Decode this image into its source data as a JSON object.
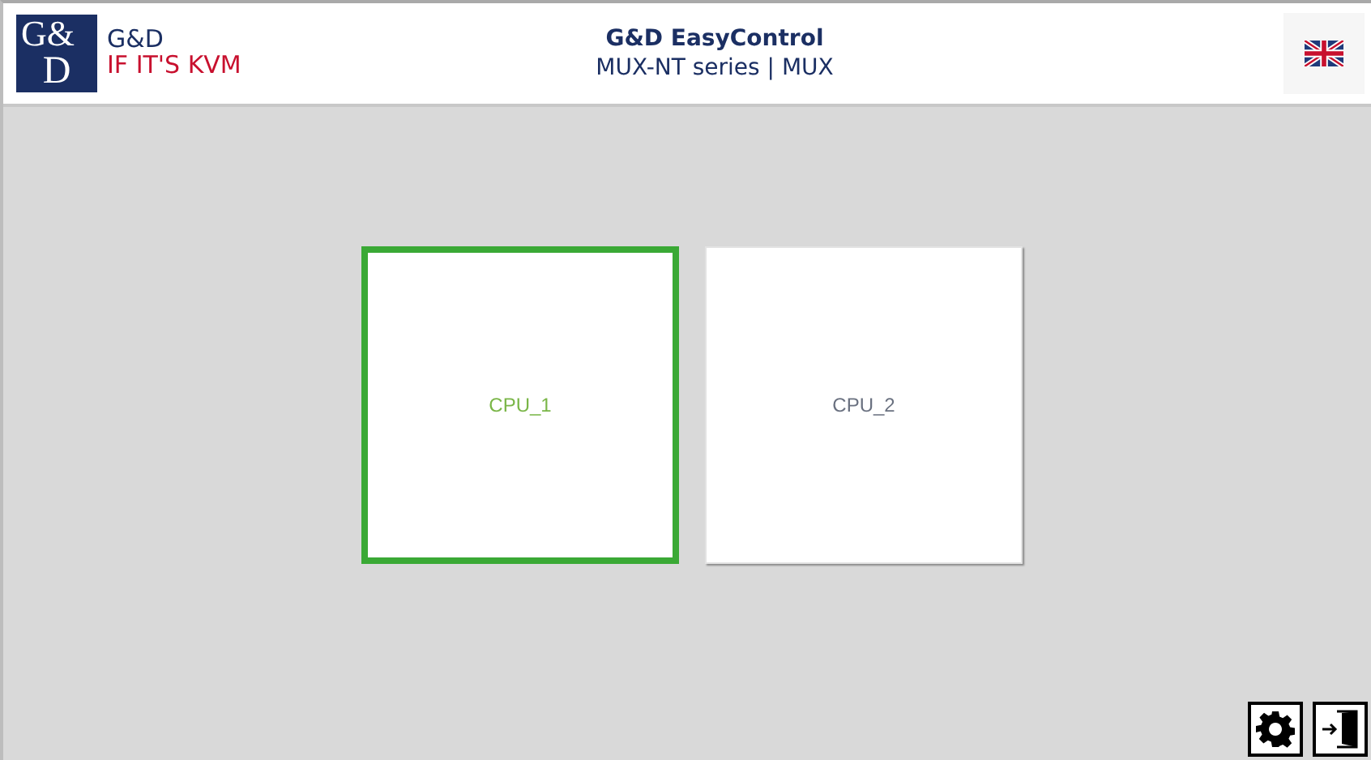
{
  "header": {
    "logo_mark": [
      "G&",
      "D"
    ],
    "brand": "G&D",
    "slogan": "IF IT'S KVM",
    "title": "G&D EasyControl",
    "subtitle": "MUX-NT series | MUX"
  },
  "channels": [
    {
      "label": "CPU_1",
      "selected": true
    },
    {
      "label": "CPU_2",
      "selected": false
    }
  ],
  "toolbar": [
    {
      "kind": "settings"
    },
    {
      "kind": "logout"
    }
  ]
}
